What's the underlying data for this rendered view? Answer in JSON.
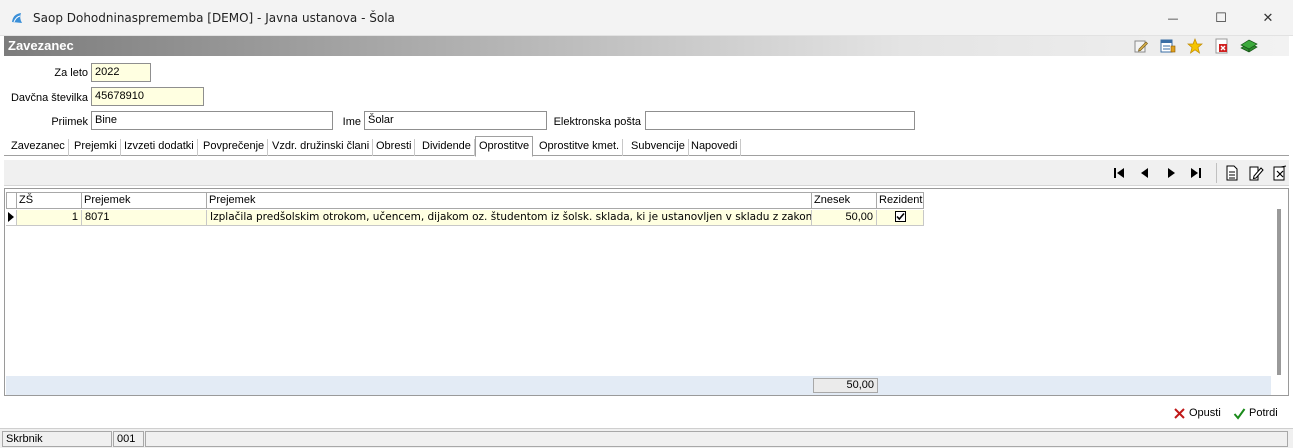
{
  "window": {
    "title": "Saop Dohodninasprememba [DEMO] - Javna ustanova - Šola",
    "minimize_glyph": "—",
    "maximize_glyph": "☐",
    "close_glyph": "✕"
  },
  "form": {
    "title": "Zavezanec",
    "toolbar_icons": [
      "edit-icon",
      "list-settings-icon",
      "favorite-star-icon",
      "pdf-close-icon",
      "books-exit-icon"
    ]
  },
  "fields": {
    "year": {
      "label": "Za leto",
      "value": "2022"
    },
    "tax_number": {
      "label": "Davčna številka",
      "value": "45678910"
    },
    "surname": {
      "label": "Priimek",
      "value": "Bine"
    },
    "name": {
      "label": "Ime",
      "value": "Šolar"
    },
    "email": {
      "label": "Elektronska pošta",
      "value": ""
    }
  },
  "tabs": [
    {
      "label": "Zavezanec"
    },
    {
      "label": "Prejemki"
    },
    {
      "label": "Izvzeti dodatki"
    },
    {
      "label": "Povprečenje"
    },
    {
      "label": "Vzdr. družinski člani"
    },
    {
      "label": "Obresti"
    },
    {
      "label": "Dividende"
    },
    {
      "label": "Oprostitve",
      "active": true
    },
    {
      "label": "Oprostitve kmet."
    },
    {
      "label": "Subvencije"
    },
    {
      "label": "Napovedi"
    }
  ],
  "grid": {
    "columns": [
      "ZŠ",
      "Prejemek",
      "Prejemek",
      "Znesek",
      "Rezident"
    ],
    "rows": [
      {
        "zs": "1",
        "prejemek_code": "8071",
        "prejemek_desc": "Izplačila predšolskim otrokom, učencem, dijakom oz. študentom iz šolsk. sklada, ki je ustanovljen v skladu z zakonom,...",
        "znesek": "50,00",
        "rezident": true
      }
    ],
    "total": "50,00"
  },
  "actions": {
    "cancel": "Opusti",
    "confirm": "Potrdi"
  },
  "statusbar": {
    "left": "Skrbnik",
    "code": "001"
  }
}
